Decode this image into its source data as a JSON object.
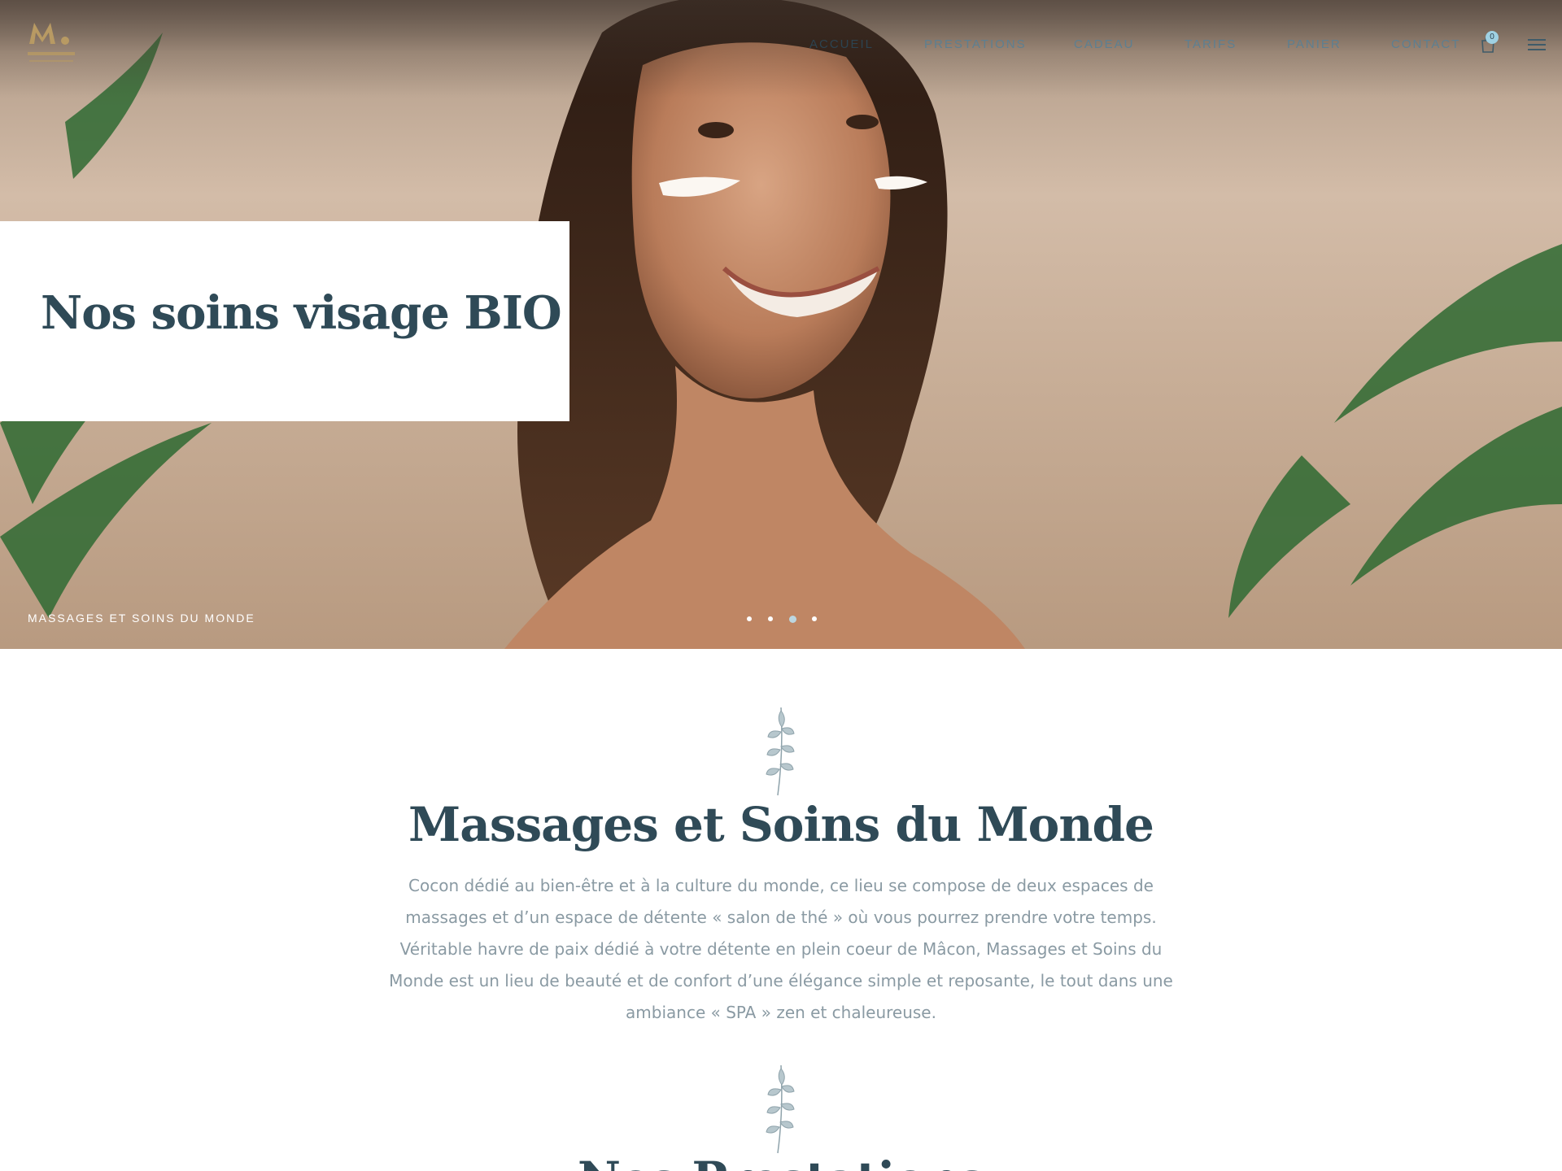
{
  "brand": {
    "logo_text": "MASSAGES",
    "logo_subtext": "& SOINS DU MONDE"
  },
  "nav": {
    "items": [
      {
        "label": "ACCUEIL",
        "active": true
      },
      {
        "label": "PRESTATIONS",
        "active": false
      },
      {
        "label": "CADEAU",
        "active": false
      },
      {
        "label": "TARIFS",
        "active": false
      },
      {
        "label": "PANIER",
        "active": false
      },
      {
        "label": "CONTACT",
        "active": false
      }
    ],
    "cart_count": "0"
  },
  "hero": {
    "title": "Nos soins visage BIO",
    "caption": "MASSAGES ET SOINS DU MONDE",
    "slide_count": 4,
    "active_slide": 3
  },
  "about": {
    "title": "Massages et Soins du Monde",
    "text": "Cocon dédié au bien-être et à la culture du monde, ce lieu se compose de deux espaces de massages et d’un espace de détente « salon de thé » où vous pourrez prendre votre temps. Véritable havre de paix dédié à votre détente en plein coeur de Mâcon, Massages et Soins du Monde est un lieu de beauté et de confort d’une élégance simple et reposante, le tout dans une ambiance « SPA » zen et chaleureuse."
  },
  "services": {
    "title": "Nos Prestations"
  },
  "colors": {
    "heading": "#2f4a57",
    "nav": "#5d7f91",
    "body_text": "#8a9aa3",
    "accent": "#9fd1e3",
    "logo_gold": "#b89a63"
  }
}
